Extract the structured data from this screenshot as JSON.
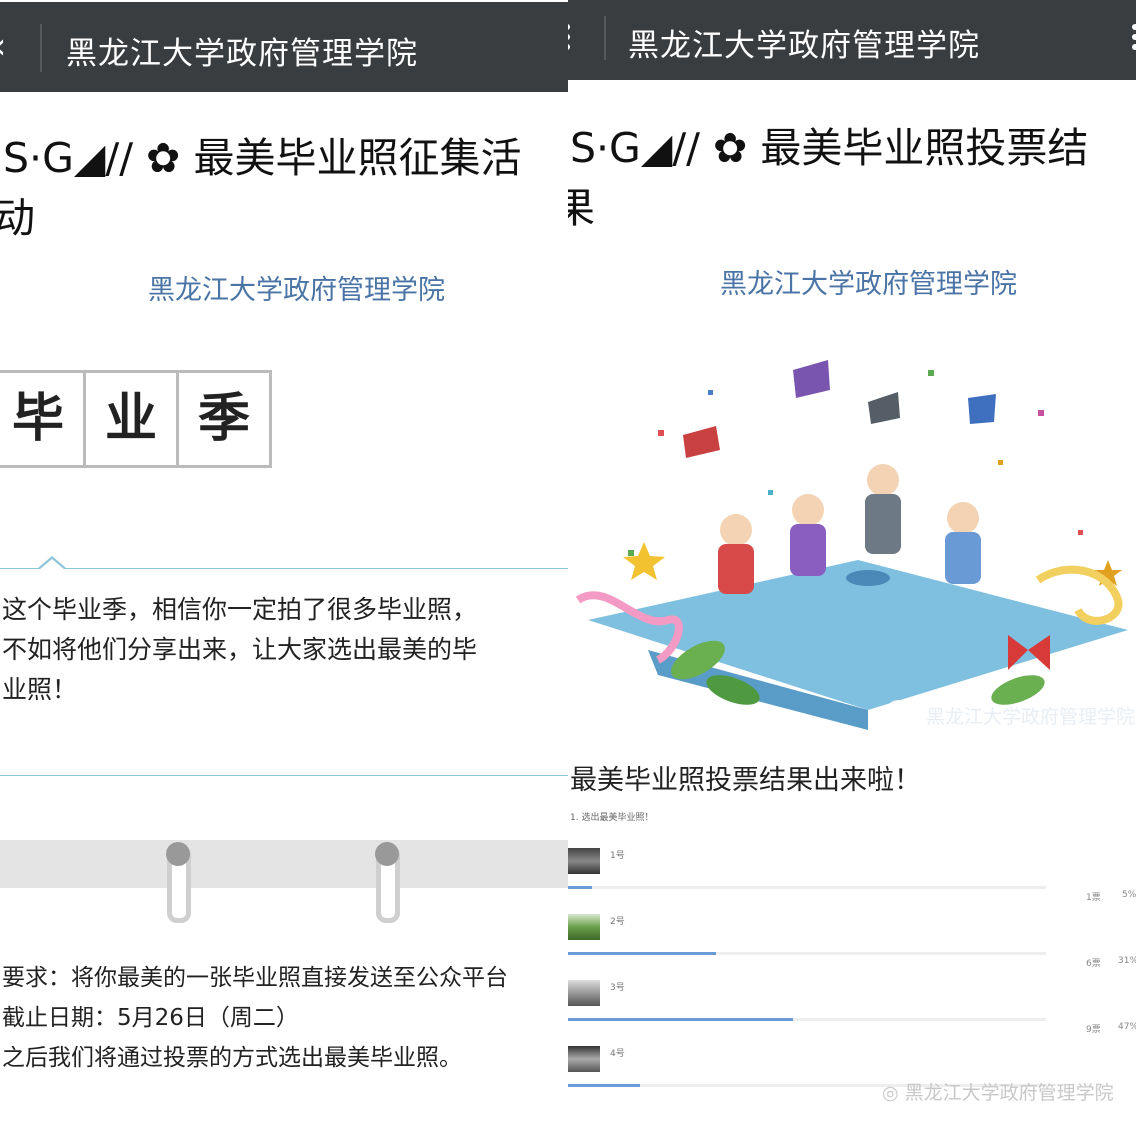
{
  "left_panel": {
    "topbar": {
      "title": "黑龙江大学政府管理学院",
      "back_icon": "‹"
    },
    "article_title": [
      "’S·G◢// ✿ 最美毕业照征集活",
      "动"
    ],
    "author": "黑龙江大学政府管理学院",
    "grid_chars": [
      "毕",
      "业",
      "季"
    ],
    "intro_lines": [
      "这个毕业季，相信你一定拍了很多毕业照，",
      "不如将他们分享出来，让大家选出最美的毕",
      "业照！"
    ],
    "requirements": [
      "要求：将你最美的一张毕业照直接发送至公众平台",
      "截止日期：5月26日（周二）",
      "之后我们将通过投票的方式选出最美毕业照。"
    ]
  },
  "right_panel": {
    "topbar": {
      "title": "黑龙江大学政府管理学院"
    },
    "article_title": [
      "S·G◢// ✿ 最美毕业照投票结",
      "果"
    ],
    "author": "黑龙江大学政府管理学院",
    "illustration_watermark": "黑龙江大学政府管理学院",
    "result_heading": "最美毕业照投票结果出来啦！",
    "poll": {
      "question": "1. 选出最美毕业照！",
      "options": [
        {
          "label": "1号",
          "votes_text": "1票",
          "percent_text": "5%",
          "fraction": 0.05
        },
        {
          "label": "2号",
          "votes_text": "6票",
          "percent_text": "31%",
          "fraction": 0.31
        },
        {
          "label": "3号",
          "votes_text": "9票",
          "percent_text": "47%",
          "fraction": 0.47
        },
        {
          "label": "4号",
          "votes_text": "",
          "percent_text": "",
          "fraction": 0.15
        }
      ]
    },
    "bottom_watermark": "黑龙江大学政府管理学院"
  },
  "colors": {
    "topbar": "#3a3d3f",
    "author_link": "#4a74a6",
    "bubble_border": "#8ec3d9",
    "poll_bar": "#6a9bd6"
  }
}
